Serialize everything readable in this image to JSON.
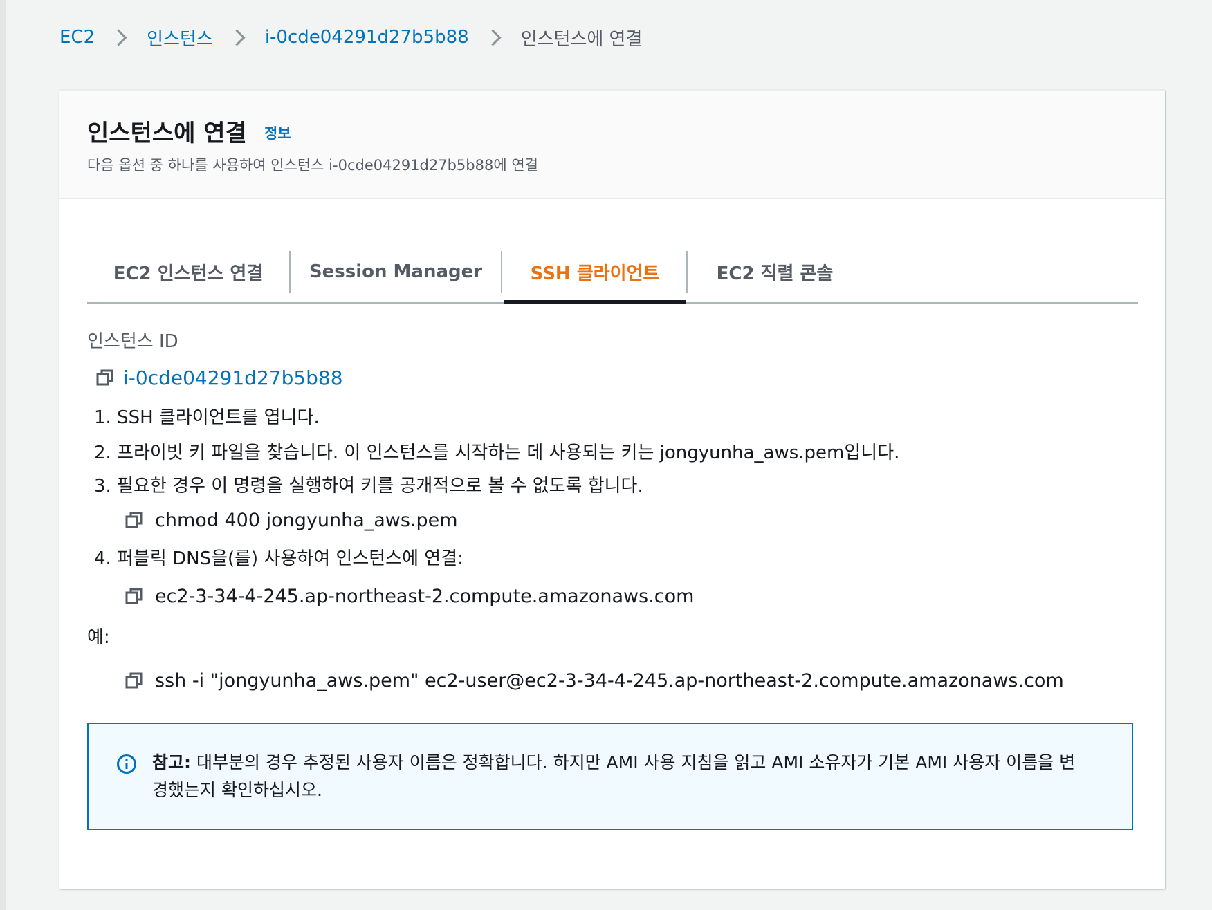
{
  "breadcrumb": {
    "items": [
      {
        "label": "EC2"
      },
      {
        "label": "인스턴스"
      },
      {
        "label": "i-0cde04291d27b5b88"
      }
    ],
    "current": "인스턴스에 연결"
  },
  "header": {
    "title": "인스턴스에 연결",
    "info": "정보",
    "description": "다음 옵션 중 하나를 사용하여 인스턴스 i-0cde04291d27b5b88에 연결"
  },
  "tabs": [
    {
      "label": "EC2 인스턴스 연결",
      "active": false
    },
    {
      "label": "Session Manager",
      "active": false
    },
    {
      "label": "SSH 클라이언트",
      "active": true
    },
    {
      "label": "EC2 직렬 콘솔",
      "active": false
    }
  ],
  "instance": {
    "label": "인스턴스 ID",
    "id": "i-0cde04291d27b5b88"
  },
  "steps": {
    "s1": "1. SSH 클라이언트를 엽니다.",
    "s2": "2. 프라이빗 키 파일을 찾습니다. 이 인스턴스를 시작하는 데 사용되는 키는 jongyunha_aws.pem입니다.",
    "s3": "3. 필요한 경우 이 명령을 실행하여 키를 공개적으로 볼 수 없도록 합니다.",
    "chmod": "chmod 400 jongyunha_aws.pem",
    "s4": "4. 퍼블릭 DNS을(를) 사용하여 인스턴스에 연결:",
    "dns": "ec2-3-34-4-245.ap-northeast-2.compute.amazonaws.com"
  },
  "example": {
    "label": "예:",
    "command": "ssh -i \"jongyunha_aws.pem\" ec2-user@ec2-3-34-4-245.ap-northeast-2.compute.amazonaws.com"
  },
  "note": {
    "strong": "참고:",
    "text": " 대부분의 경우 추정된 사용자 이름은 정확합니다. 하지만 AMI 사용 지침을 읽고 AMI 소유자가 기본 AMI 사용자 이름을 변경했는지 확인하십시오."
  },
  "colors": {
    "link": "#0073bb",
    "active_tab": "#ec7211",
    "background": "#f2f3f3",
    "alert_border": "#0073bb"
  },
  "icons": {
    "copy": "copy-icon",
    "info": "info-circle-icon",
    "separator": "chevron-right-icon"
  }
}
